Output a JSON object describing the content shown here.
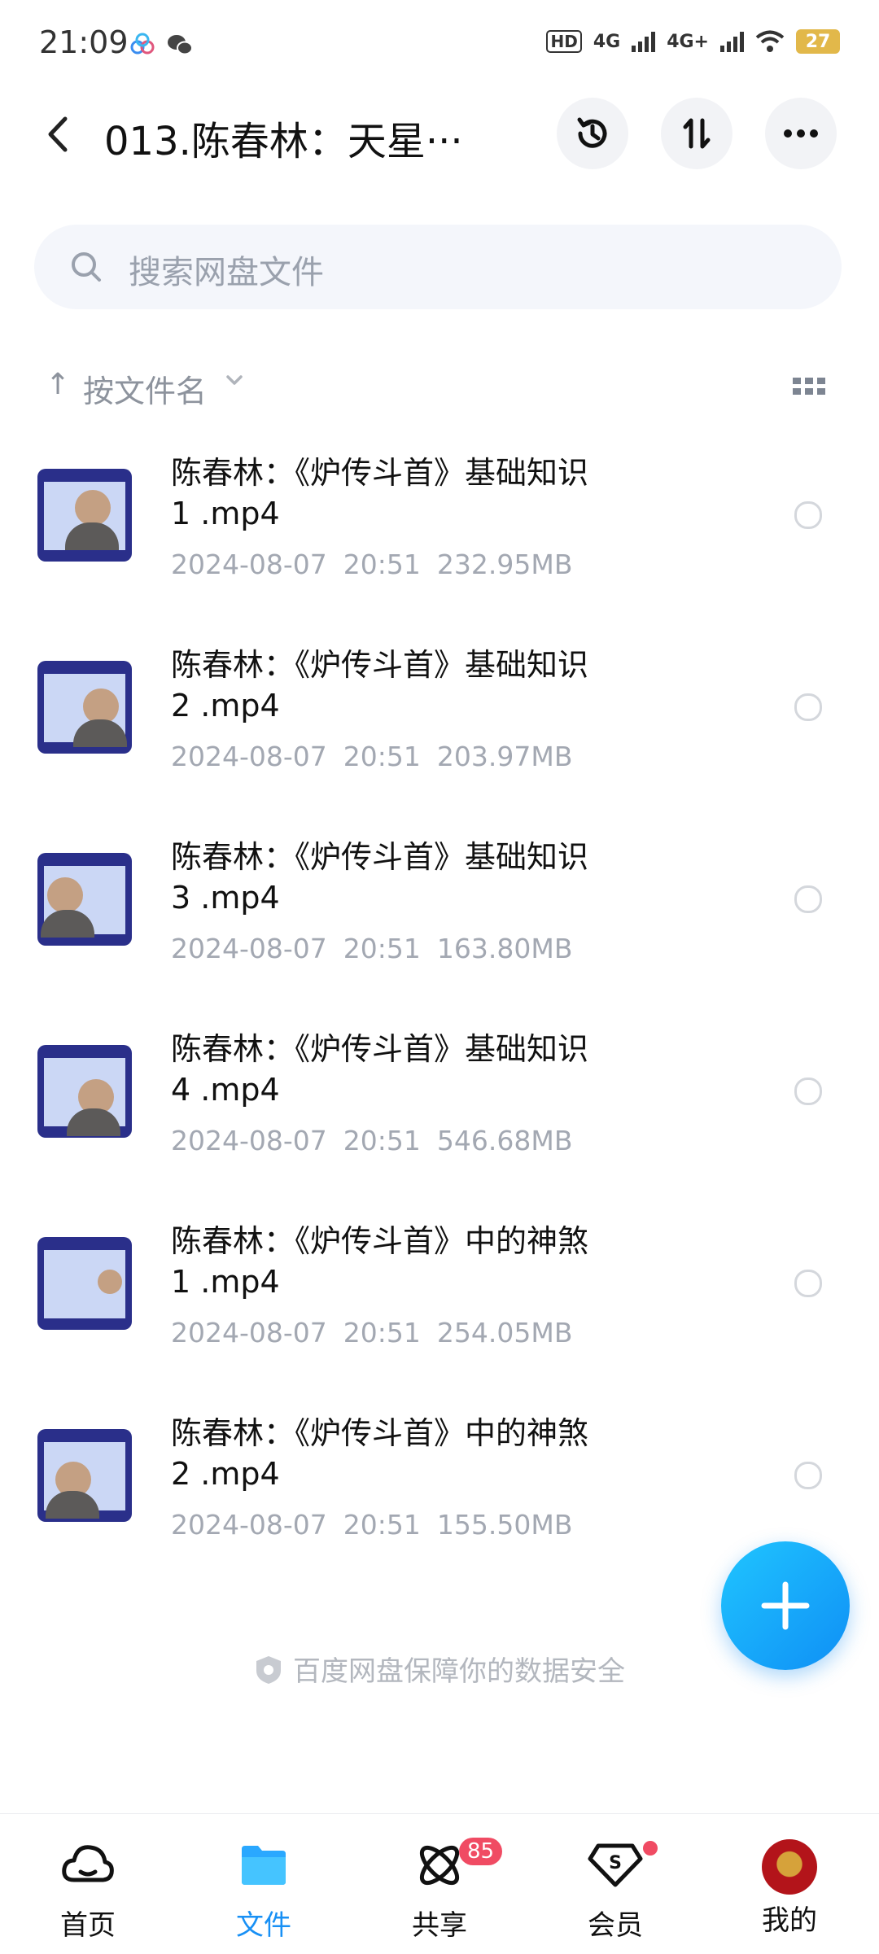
{
  "status_bar": {
    "time": "21:09",
    "hd": "HD",
    "net1": "4G",
    "net2": "4G+",
    "battery": "27"
  },
  "header": {
    "title": "013.陈春林：天星···",
    "back_icon": "back-arrow-icon",
    "history_icon": "history-icon",
    "transfer_icon": "transfer-icon",
    "more_icon": "more-icon"
  },
  "search": {
    "placeholder": "搜索网盘文件"
  },
  "sort": {
    "label": "按文件名"
  },
  "files": [
    {
      "name_line1": "陈春林：《炉传斗首》基础知识",
      "name_line2": "1 .mp4",
      "date": "2024-08-07",
      "time": "20:51",
      "size": "232.95MB"
    },
    {
      "name_line1": "陈春林：《炉传斗首》基础知识",
      "name_line2": "2 .mp4",
      "date": "2024-08-07",
      "time": "20:51",
      "size": "203.97MB"
    },
    {
      "name_line1": "陈春林：《炉传斗首》基础知识",
      "name_line2": "3 .mp4",
      "date": "2024-08-07",
      "time": "20:51",
      "size": "163.80MB"
    },
    {
      "name_line1": "陈春林：《炉传斗首》基础知识",
      "name_line2": "4 .mp4",
      "date": "2024-08-07",
      "time": "20:51",
      "size": "546.68MB"
    },
    {
      "name_line1": "陈春林：《炉传斗首》中的神煞",
      "name_line2": "1 .mp4",
      "date": "2024-08-07",
      "time": "20:51",
      "size": "254.05MB"
    },
    {
      "name_line1": "陈春林：《炉传斗首》中的神煞",
      "name_line2": "2 .mp4",
      "date": "2024-08-07",
      "time": "20:51",
      "size": "155.50MB"
    }
  ],
  "footer_note": "百度网盘保障你的数据安全",
  "nav": {
    "home": "首页",
    "files": "文件",
    "share": "共享",
    "share_badge": "85",
    "vip": "会员",
    "mine": "我的"
  },
  "colors": {
    "accent": "#1890f5",
    "badge": "#f04b63"
  }
}
